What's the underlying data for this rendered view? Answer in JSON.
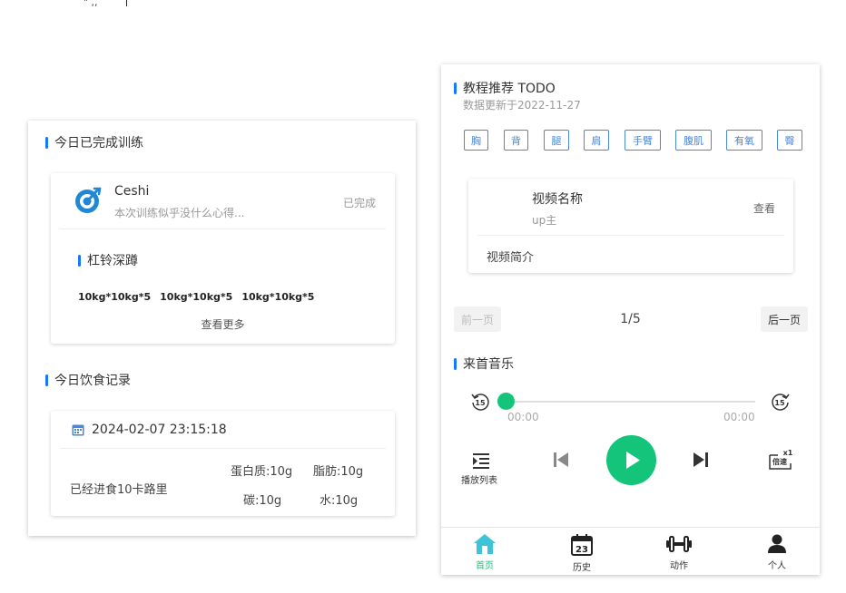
{
  "artifacts": {
    "top_text": "\" ,,"
  },
  "colors": {
    "accent_blue": "#1677ff",
    "green": "#14c47a",
    "tag_blue": "#4a86d9"
  },
  "left": {
    "training": {
      "title": "今日已完成训练",
      "trainer_name": "Ceshi",
      "trainer_note": "本次训练似乎没什么心得...",
      "status": "已完成",
      "exercise": "杠铃深蹲",
      "sets": [
        "10kg*10kg*5",
        "10kg*10kg*5",
        "10kg*10kg*5"
      ],
      "see_more": "查看更多"
    },
    "diet": {
      "title": "今日饮食记录",
      "datetime": "2024-02-07 23:15:18",
      "summary": "已经进食10卡路里",
      "protein": "蛋白质:10g",
      "fat": "脂肪:10g",
      "carbs": "碳:10g",
      "water": "水:10g"
    }
  },
  "right": {
    "recommend": {
      "title": "教程推荐 TODO",
      "subtitle": "数据更新于2022-11-27",
      "tags": [
        "胸",
        "背",
        "腿",
        "肩",
        "手臂",
        "腹肌",
        "有氧",
        "臀"
      ]
    },
    "video": {
      "name": "视频名称",
      "uploader": "up主",
      "view": "查看",
      "intro": "视频简介"
    },
    "pager": {
      "prev": "前一页",
      "page": "1/5",
      "next": "后一页"
    },
    "music": {
      "title": "来首音乐",
      "current_time": "00:00",
      "total_time": "00:00",
      "skip_seconds": "15",
      "speed": "x1",
      "speed_label": "倍速",
      "playlist_label": "播放列表"
    },
    "tabs": [
      {
        "label": "首页",
        "icon": "home-icon"
      },
      {
        "label": "历史",
        "icon": "calendar-icon"
      },
      {
        "label": "动作",
        "icon": "dumbbell-icon"
      },
      {
        "label": "个人",
        "icon": "person-icon"
      }
    ],
    "calendar_day": "23"
  }
}
